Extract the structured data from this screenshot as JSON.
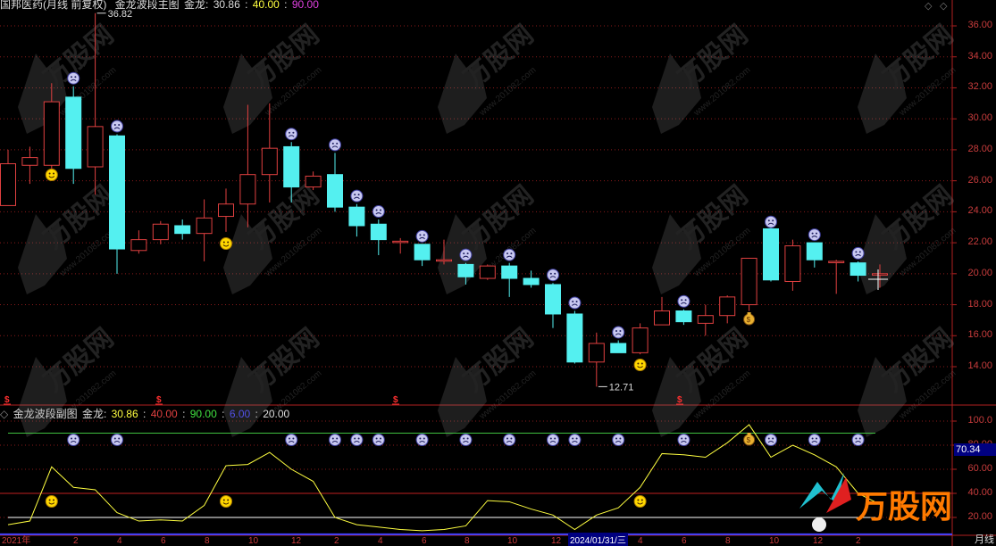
{
  "main_header": {
    "title": "国邦医药(月线 前复权)",
    "indicator": "金龙波段主图",
    "label": "金龙:",
    "values": [
      "30.86",
      "40.00",
      "90.00"
    ]
  },
  "sub_header": {
    "indicator": "金龙波段副图",
    "label": "金龙:",
    "values": [
      "30.86",
      "40.00",
      "90.00",
      "6.00",
      "20.00"
    ]
  },
  "price_axis": [
    "36.00",
    "34.00",
    "32.00",
    "30.00",
    "28.00",
    "26.00",
    "24.00",
    "22.00",
    "20.00",
    "18.00",
    "16.00",
    "14.00"
  ],
  "osc_axis": [
    "100.0",
    "80.00",
    "60.00",
    "40.00",
    "20.00"
  ],
  "current_value_chip": "70.34",
  "annotations": {
    "high": "36.82",
    "low": "12.71"
  },
  "x_axis": {
    "labels": [
      "2021年",
      "2",
      "4",
      "6",
      "8",
      "10",
      "12",
      "2",
      "4",
      "6",
      "8",
      "10",
      "12",
      "4",
      "6",
      "8",
      "10",
      "12",
      "2"
    ],
    "selected_date": "2024/01/31/三"
  },
  "period_label": "月线",
  "watermark": {
    "text": "万股网",
    "site": "www.201082.com"
  },
  "colors": {
    "up": "#e04040",
    "down": "#54f0f0",
    "osc_line": "#ffff40",
    "upper_band": "#40c040",
    "mid_band": "#c02020",
    "low_band": "#ffffff",
    "bottom_band": "#4040ff"
  },
  "chart_data": {
    "type": "candlestick",
    "candles": [
      {
        "o": 24.4,
        "c": 27.1,
        "h": 28.0,
        "l": 24.4
      },
      {
        "o": 27.0,
        "c": 27.5,
        "h": 28.2,
        "l": 25.8
      },
      {
        "o": 27.0,
        "c": 31.1,
        "h": 32.3,
        "l": 26.2
      },
      {
        "o": 31.4,
        "c": 26.8,
        "h": 32.1,
        "l": 25.8
      },
      {
        "o": 26.9,
        "c": 29.5,
        "h": 36.82,
        "l": 25.1
      },
      {
        "o": 28.9,
        "c": 21.6,
        "h": 29.0,
        "l": 20.0
      },
      {
        "o": 21.5,
        "c": 22.2,
        "h": 22.8,
        "l": 21.3
      },
      {
        "o": 22.2,
        "c": 23.2,
        "h": 23.4,
        "l": 21.9
      },
      {
        "o": 23.1,
        "c": 22.6,
        "h": 23.5,
        "l": 22.2
      },
      {
        "o": 22.6,
        "c": 23.6,
        "h": 24.8,
        "l": 20.8
      },
      {
        "o": 23.7,
        "c": 24.5,
        "h": 25.5,
        "l": 22.7
      },
      {
        "o": 24.5,
        "c": 26.4,
        "h": 30.9,
        "l": 23.0
      },
      {
        "o": 26.4,
        "c": 28.1,
        "h": 31.0,
        "l": 24.6
      },
      {
        "o": 28.2,
        "c": 25.6,
        "h": 28.5,
        "l": 24.6
      },
      {
        "o": 25.6,
        "c": 26.3,
        "h": 26.6,
        "l": 25.4
      },
      {
        "o": 26.4,
        "c": 24.3,
        "h": 27.8,
        "l": 24.0
      },
      {
        "o": 24.3,
        "c": 23.1,
        "h": 24.5,
        "l": 22.4
      },
      {
        "o": 23.2,
        "c": 22.2,
        "h": 23.5,
        "l": 21.2
      },
      {
        "o": 22.1,
        "c": 22.1,
        "h": 22.3,
        "l": 21.3
      },
      {
        "o": 21.9,
        "c": 20.9,
        "h": 21.9,
        "l": 20.5
      },
      {
        "o": 20.9,
        "c": 20.9,
        "h": 22.2,
        "l": 20.6
      },
      {
        "o": 20.6,
        "c": 19.8,
        "h": 20.7,
        "l": 19.3
      },
      {
        "o": 19.7,
        "c": 20.5,
        "h": 20.6,
        "l": 19.6
      },
      {
        "o": 20.5,
        "c": 19.7,
        "h": 20.7,
        "l": 18.5
      },
      {
        "o": 19.7,
        "c": 19.3,
        "h": 20.2,
        "l": 19.1
      },
      {
        "o": 19.3,
        "c": 17.4,
        "h": 19.4,
        "l": 16.5
      },
      {
        "o": 17.4,
        "c": 14.3,
        "h": 17.6,
        "l": 14.2
      },
      {
        "o": 14.3,
        "c": 15.5,
        "h": 16.2,
        "l": 12.71
      },
      {
        "o": 15.5,
        "c": 14.9,
        "h": 15.7,
        "l": 14.9
      },
      {
        "o": 14.9,
        "c": 16.5,
        "h": 16.8,
        "l": 14.8
      },
      {
        "o": 16.7,
        "c": 17.6,
        "h": 18.5,
        "l": 16.7
      },
      {
        "o": 17.6,
        "c": 16.9,
        "h": 17.7,
        "l": 16.7
      },
      {
        "o": 16.8,
        "c": 17.3,
        "h": 18.0,
        "l": 16.0
      },
      {
        "o": 17.3,
        "c": 18.5,
        "h": 18.6,
        "l": 16.8
      },
      {
        "o": 18.0,
        "c": 21.0,
        "h": 21.0,
        "l": 17.6
      },
      {
        "o": 22.9,
        "c": 19.6,
        "h": 23.0,
        "l": 19.5
      },
      {
        "o": 19.5,
        "c": 21.8,
        "h": 22.2,
        "l": 18.9
      },
      {
        "o": 22.0,
        "c": 20.9,
        "h": 22.0,
        "l": 20.4
      },
      {
        "o": 20.8,
        "c": 20.8,
        "h": 20.9,
        "l": 18.7
      },
      {
        "o": 20.7,
        "c": 19.9,
        "h": 20.8,
        "l": 19.5
      },
      {
        "o": 20.0,
        "c": 20.0,
        "h": 20.6,
        "l": 19.1
      }
    ],
    "oscillator": {
      "name": "金龙",
      "values": [
        14,
        17,
        62,
        45,
        43,
        24,
        17,
        18,
        17,
        30,
        63,
        64,
        74,
        60,
        50,
        20,
        14,
        12,
        10,
        9,
        10,
        13,
        34,
        33,
        27,
        22,
        10,
        22,
        28,
        45,
        73,
        72,
        70,
        82,
        97,
        70,
        80,
        72,
        62,
        40,
        30.86
      ],
      "bands": [
        90,
        40,
        20,
        6
      ]
    }
  }
}
